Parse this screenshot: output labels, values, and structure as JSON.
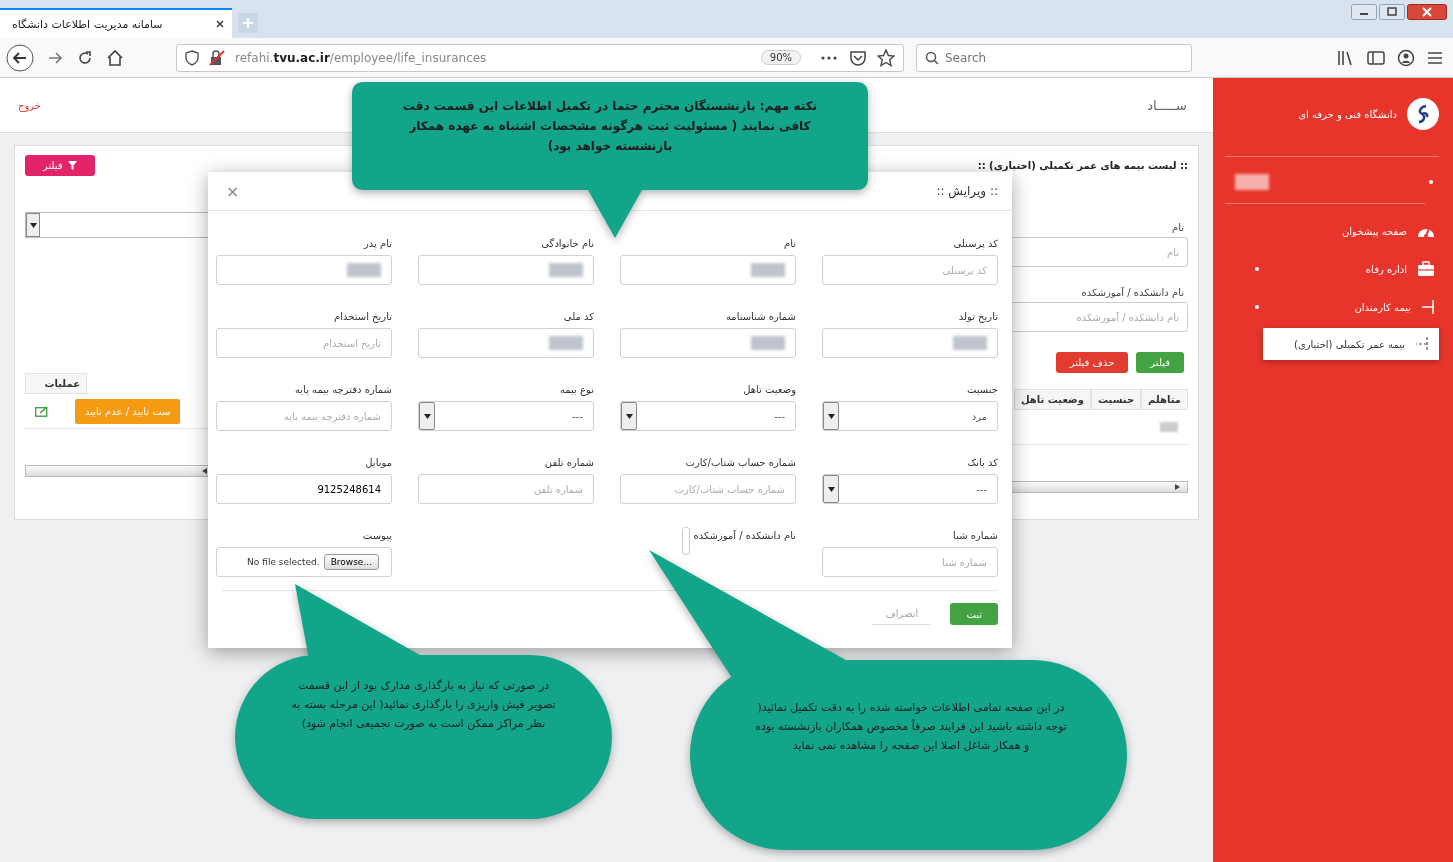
{
  "browser": {
    "tab_title": "سامانه مدیریت اطلاعات دانشگاه",
    "url": "refahi.**tvu.ac.ir**/employee/life_insurances",
    "zoom": "90%",
    "search_placeholder": "Search"
  },
  "header": {
    "exit": "خروج",
    "brand": "ســـــاد"
  },
  "sidebar": {
    "org": "دانشگاه فنی و حرفه ای",
    "items": [
      {
        "label": "صفحه پیشخوان",
        "kind": "dashboard",
        "has_submenu": false,
        "selected": false
      },
      {
        "label": "اداره رفاه",
        "kind": "briefcase",
        "has_submenu": true,
        "selected": false
      },
      {
        "label": "بیمه کارمندان",
        "kind": "branch",
        "has_submenu": true,
        "selected": false,
        "children": [
          {
            "label": "بیمه عمر تکمیلی (اختیاری)",
            "selected": true
          }
        ]
      }
    ]
  },
  "page": {
    "title": ":: لیست بیمه های عمر تکمیلی (اختیاری) ::",
    "filter_button": "فیلتر",
    "filter_fields": [
      {
        "label": "نام",
        "placeholder": "نام"
      },
      {
        "label": "نام دانشکده / آموزشکده",
        "placeholder": "نام دانشکده / آموزشکده"
      }
    ],
    "apply_button": "فیلتر",
    "clear_button": "حذف فیلتر",
    "columns": [
      "متاهلم",
      "جنسیت",
      "وضعیت تاهل"
    ],
    "actions_column": "عملیات",
    "status_button": "ست تایید / عدم تایید"
  },
  "modal": {
    "title": ":: ویرایش ::",
    "close": "×",
    "fields": [
      {
        "label": "کد پرسنلی",
        "kind": "text",
        "placeholder": "کد پرسنلی"
      },
      {
        "label": "نام",
        "kind": "redacted"
      },
      {
        "label": "نام خانوادگی",
        "kind": "redacted"
      },
      {
        "label": "نام پدر",
        "kind": "redacted"
      },
      {
        "label": "تاریخ تولد",
        "kind": "redacted"
      },
      {
        "label": "شماره شناسنامه",
        "kind": "redacted"
      },
      {
        "label": "کد ملی",
        "kind": "redacted"
      },
      {
        "label": "تاریخ استخدام",
        "kind": "text",
        "placeholder": "تاریخ استخدام"
      },
      {
        "label": "جنسیت",
        "kind": "select",
        "value": "مرد"
      },
      {
        "label": "وضعیت تاهل",
        "kind": "select",
        "value": "---"
      },
      {
        "label": "نوع بیمه",
        "kind": "select",
        "value": "---"
      },
      {
        "label": "شماره دفترچه بیمه پایه",
        "kind": "text",
        "placeholder": "شماره دفترچه بیمه پایه"
      },
      {
        "label": "کد بانک",
        "kind": "select",
        "value": "---"
      },
      {
        "label": "شماره حساب شتاب/کارت",
        "kind": "text",
        "placeholder": "شماره حساب شتاب/کارت"
      },
      {
        "label": "شماره تلفن",
        "kind": "text",
        "placeholder": "شماره تلفن"
      },
      {
        "label": "موبایل",
        "kind": "text",
        "value": "9125248614"
      },
      {
        "label": "شماره شبا",
        "kind": "text",
        "placeholder": "شماره شبا"
      },
      {
        "label": "نام دانشکده / آموزشکده",
        "kind": "collapsed"
      },
      {
        "label": "پیوست",
        "kind": "file",
        "file_status": "No file selected.",
        "browse": "Browse..."
      }
    ],
    "submit": "ثبت",
    "cancel": "انصراف"
  },
  "callouts": [
    {
      "text": "نکته مهم: بازنشستگان محترم حتما در تکمیل اطلاعات این قسمت دقت کافی نمایند ( مسئولیت ثبت هرگونه مشخصات اشتباه به عهده همکار بازنشسته خواهد بود)"
    },
    {
      "text": "در صورتی که نیاز به بارگذاری مدارک بود از این قسمت تصویر فیش واریزی را بارگذاری نمائید( این مرحله بسته به نظر مراکز ممکن است به صورت تجمیعی انجام شود)"
    },
    {
      "text": "در این صفحه تمامی اطلاعات خواسته شده را به دقت تکمیل نمائید( توجه داشته باشید این فرایند صرفاً مخصوص همکاران بازنشسته بوده و همکار شاغل اصلا این صفحه را مشاهده نمی نماید"
    }
  ]
}
